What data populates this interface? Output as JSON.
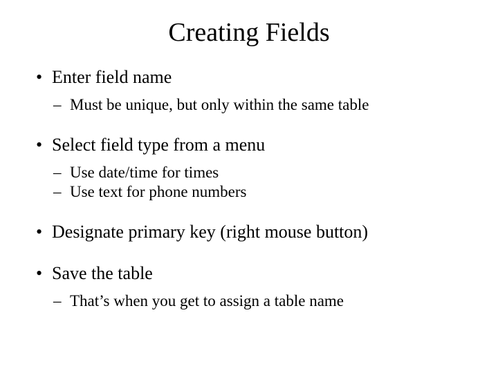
{
  "title": "Creating Fields",
  "bullets": {
    "b0": {
      "text": "Enter field name",
      "sub": {
        "s0": "Must be unique, but only within the same table"
      }
    },
    "b1": {
      "text": "Select field type from a menu",
      "sub": {
        "s0": "Use date/time for times",
        "s1": "Use text for phone numbers"
      }
    },
    "b2": {
      "text": "Designate primary key (right mouse button)"
    },
    "b3": {
      "text": "Save the table",
      "sub": {
        "s0": "That’s when you get to assign a table name"
      }
    }
  }
}
